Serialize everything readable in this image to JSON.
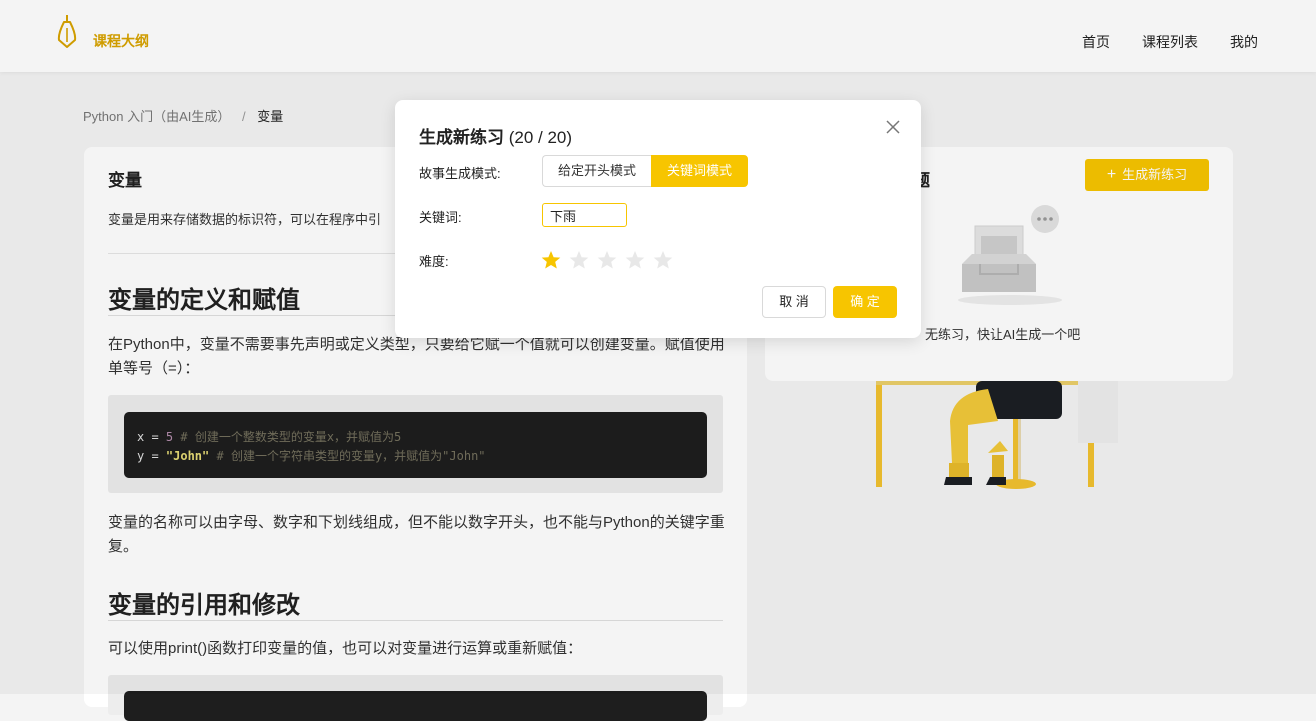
{
  "header": {
    "logo_text": "课程大纲",
    "nav": [
      "首页",
      "课程列表",
      "我的"
    ]
  },
  "breadcrumb": {
    "parent": "Python 入门（由AI生成）",
    "separator": "/",
    "current": "变量"
  },
  "lesson": {
    "title": "变量",
    "description": "变量是用来存储数据的标识符，可以在程序中引",
    "section1_title": "变量的定义和赋值",
    "section1_para": "在Python中，变量不需要事先声明或定义类型，只要给它赋一个值就可以创建变量。赋值使用单等号（=）：",
    "code": {
      "line1_var": "x = ",
      "line1_num": "5",
      "line1_comment": " # 创建一个整数类型的变量x，并赋值为5",
      "line2_var": "y = ",
      "line2_str": "\"John\"",
      "line2_comment": " # 创建一个字符串类型的变量y，并赋值为\"John\""
    },
    "section1_para2": "变量的名称可以由字母、数字和下划线组成，但不能以数字开头，也不能与Python的关键字重复。",
    "section2_title": "变量的引用和修改",
    "section2_para": "可以使用print()函数打印变量的值，也可以对变量进行运算或重新赋值："
  },
  "exercise_panel": {
    "title": "题",
    "generate_label": "生成新练习",
    "empty_text": "无练习，快让AI生成一个吧"
  },
  "modal": {
    "title": "生成新练习",
    "count": "(20 / 20)",
    "mode_label": "故事生成模式:",
    "modes": [
      "给定开头模式",
      "关键词模式"
    ],
    "active_mode": "关键词模式",
    "keyword_label": "关键词:",
    "keyword_value": "下雨",
    "difficulty_label": "难度:",
    "difficulty": {
      "value": 1,
      "max": 5
    },
    "cancel_label": "取 消",
    "ok_label": "确 定"
  },
  "colors": {
    "accent": "#f7c500",
    "brand_text": "#d9a400",
    "star_empty": "#e8e8e8"
  }
}
